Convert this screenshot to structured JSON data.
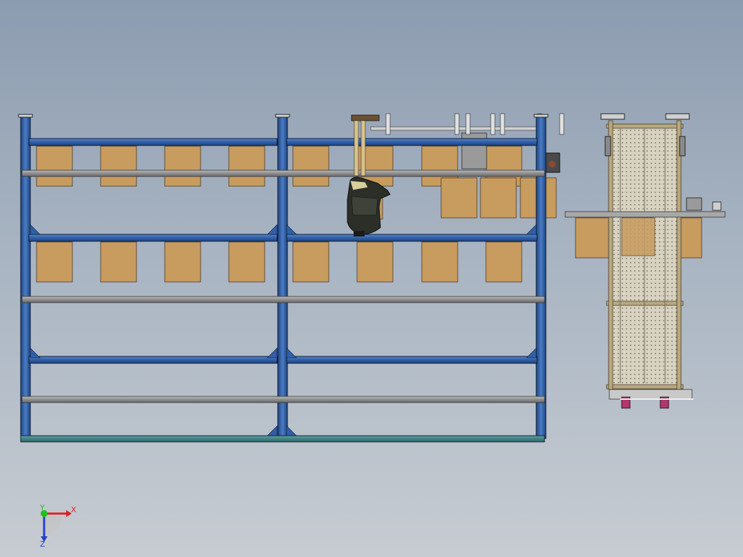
{
  "viewport": {
    "background_top": "#8c9cb0",
    "background_bottom": "#c7ccd2"
  },
  "colors": {
    "frame_blue": "#2f5fa8",
    "frame_outline": "#0c1a33",
    "rail_gray": "#8e8e8e",
    "box_tan": "#c89b5e",
    "base_teal": "#3d7f86",
    "side_frame": "#b9a77e",
    "robot_dark": "#2c2f28"
  },
  "triad": {
    "x_label": "X",
    "y_label": "Y",
    "z_label": "Z",
    "x_color": "#e02020",
    "y_color": "#20c020",
    "z_color": "#2040d0"
  }
}
